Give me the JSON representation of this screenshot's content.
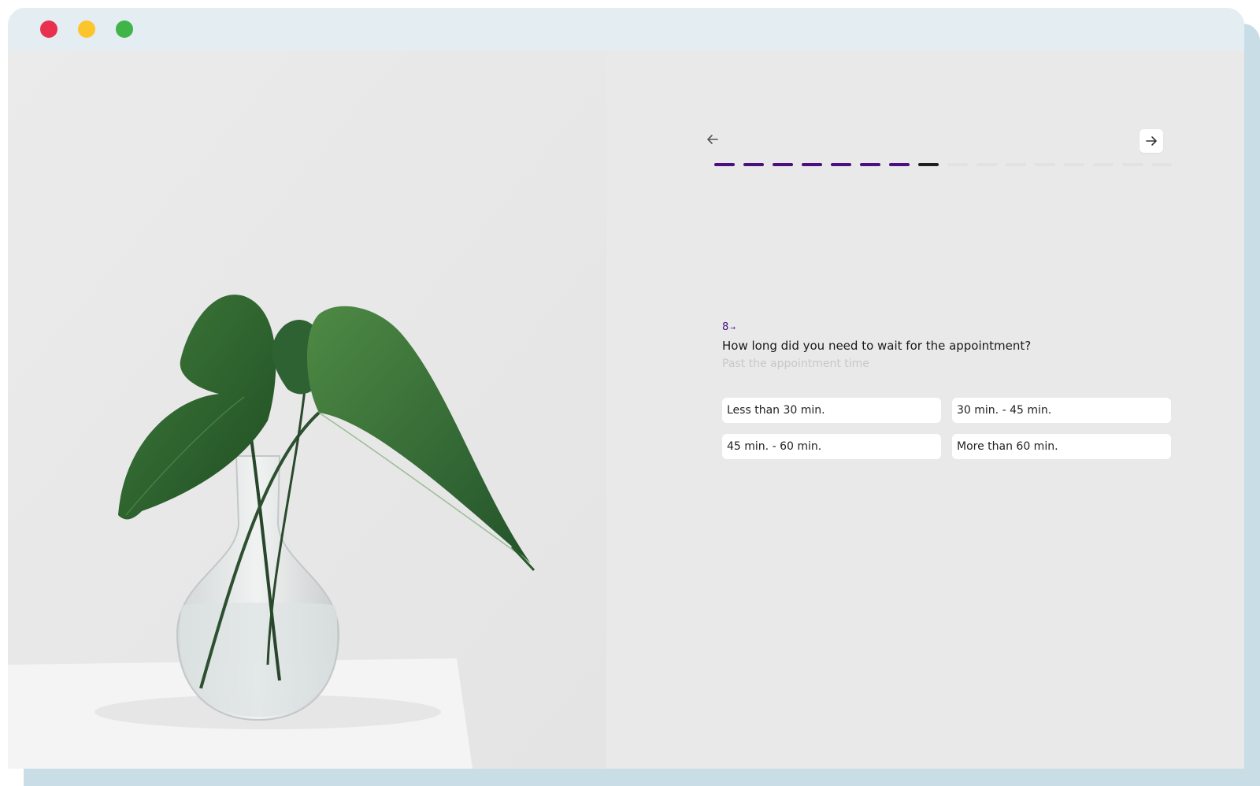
{
  "window": {
    "controls": [
      "close",
      "minimize",
      "maximize"
    ],
    "colors": {
      "close": "#e8304f",
      "minimize": "#fdc52c",
      "maximize": "#3fb449"
    }
  },
  "navigation": {
    "back_icon": "arrow-left-icon",
    "next_icon": "arrow-right-icon"
  },
  "progress": {
    "total": 16,
    "completed": 7,
    "current": 8,
    "accent": "#4a0f80"
  },
  "question": {
    "number": "8",
    "text": "How long did you need to wait for the appointment?",
    "hint": "Past the appointment time"
  },
  "options": [
    {
      "label": "Less than 30 min."
    },
    {
      "label": "30 min. - 45 min."
    },
    {
      "label": "45 min. - 60 min."
    },
    {
      "label": "More than 60 min."
    }
  ]
}
